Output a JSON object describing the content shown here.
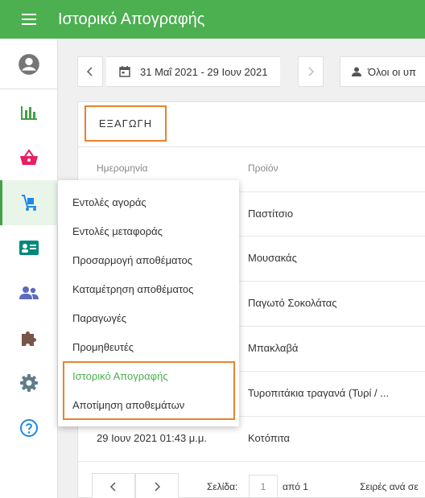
{
  "header": {
    "title": "Ιστορικό Απογραφής"
  },
  "colors": {
    "primary": "#4caf50",
    "highlight": "#e8822d"
  },
  "sidebar": {
    "items": [
      {
        "icon": "account-circle-icon",
        "color": "#757575"
      },
      {
        "icon": "bar-chart-icon",
        "color": "#43a047"
      },
      {
        "icon": "shopping-basket-icon",
        "color": "#e91e63"
      },
      {
        "icon": "hand-truck-icon",
        "color": "#1e88e5",
        "active": true
      },
      {
        "icon": "contact-card-icon",
        "color": "#00897b"
      },
      {
        "icon": "people-icon",
        "color": "#5c6bc0"
      },
      {
        "icon": "puzzle-icon",
        "color": "#795548"
      },
      {
        "icon": "settings-icon",
        "color": "#607d8b"
      },
      {
        "icon": "help-circle-icon",
        "color": "#1e88e5"
      }
    ]
  },
  "toolbar": {
    "date_range": "31 Μαΐ 2021 - 29 Ιουν 2021",
    "users": "Όλοι οι υπ"
  },
  "export_label": "ΕΞΑΓΩΓΗ",
  "table": {
    "headers": [
      "Ημερομηνία",
      "Προϊόν"
    ],
    "rows": [
      {
        "date": "",
        "product": "Παστίτσιο"
      },
      {
        "date": "",
        "product": "Μουσακάς"
      },
      {
        "date": "",
        "product": "Παγωτό Σοκολάτας"
      },
      {
        "date": "",
        "product": "Μπακλαβά"
      },
      {
        "date": "",
        "product": "Τυροπιτάκια τραγανά (Τυρί / ..."
      },
      {
        "date": "29 Ιουν 2021 01:43 μ.μ.",
        "product": "Κοτόπιτα"
      }
    ]
  },
  "pagination": {
    "page_label": "Σελίδα:",
    "page_value": "1",
    "of_label": "από 1",
    "rows_label": "Σειρές ανά σε"
  },
  "menu": {
    "items": [
      "Εντολές αγοράς",
      "Εντολές μεταφοράς",
      "Προσαρμογή αποθέματος",
      "Καταμέτρηση αποθέματος",
      "Παραγωγές",
      "Προμηθευτές",
      "Ιστορικό Απογραφής",
      "Αποτίμηση αποθεμάτων"
    ],
    "selected": "Ιστορικό Απογραφής"
  }
}
